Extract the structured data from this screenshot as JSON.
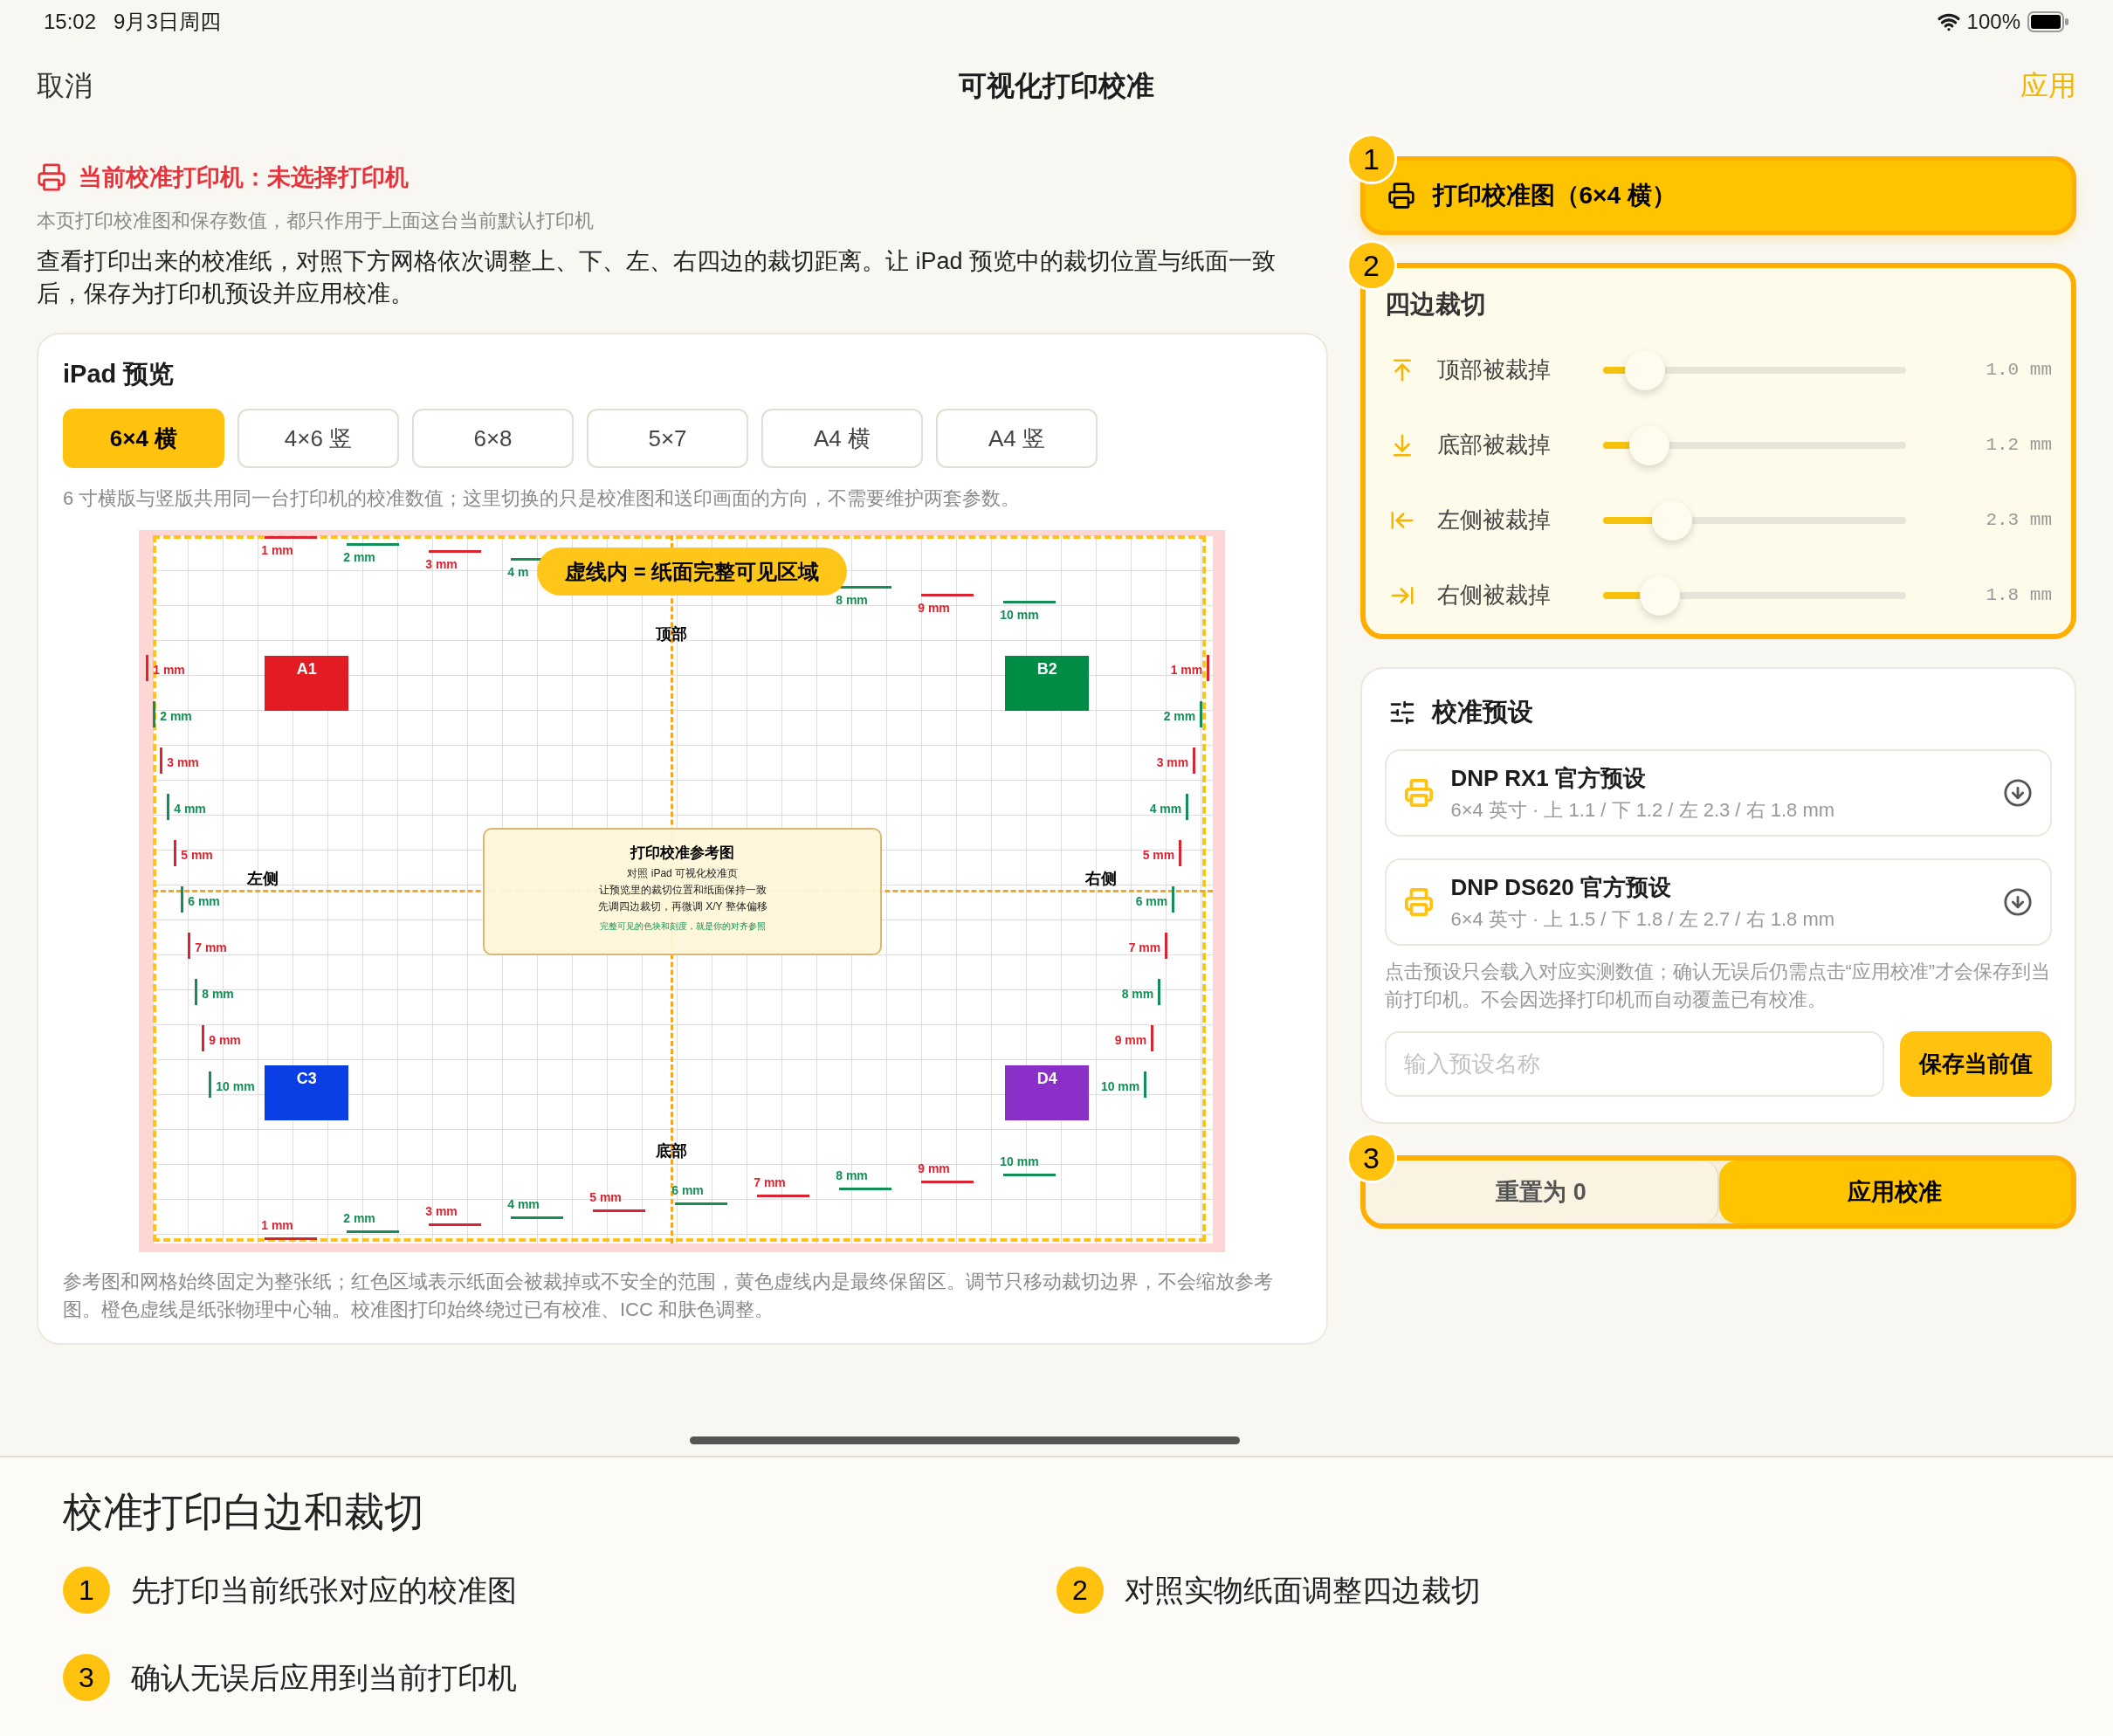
{
  "status_bar": {
    "time": "15:02",
    "date": "9月3日周四",
    "battery": "100%"
  },
  "nav": {
    "cancel": "取消",
    "title": "可视化打印校准",
    "apply": "应用"
  },
  "printer": {
    "label": "当前校准打印机：未选择打印机",
    "note": "本页打印校准图和保存数值，都只作用于上面这台当前默认打印机",
    "instructions": "查看打印出来的校准纸，对照下方网格依次调整上、下、左、右四边的裁切距离。让 iPad 预览中的裁切位置与纸面一致后，保存为打印机预设并应用校准。"
  },
  "preview": {
    "title": "iPad 预览",
    "tabs": [
      {
        "label": "6×4 横",
        "selected": true
      },
      {
        "label": "4×6 竖",
        "selected": false
      },
      {
        "label": "6×8",
        "selected": false
      },
      {
        "label": "5×7",
        "selected": false
      },
      {
        "label": "A4 横",
        "selected": false
      },
      {
        "label": "A4 竖",
        "selected": false
      }
    ],
    "note": "6 寸横版与竖版共用同一台打印机的校准数值；这里切换的只是校准图和送印画面的方向，不需要维护两套参数。",
    "chart": {
      "badge": "虚线内 = 纸面完整可见区域",
      "labels": [
        {
          "text": "顶部",
          "kind": "top"
        },
        {
          "text": "左侧",
          "kind": "left"
        },
        {
          "text": "右侧",
          "kind": "right"
        },
        {
          "text": "底部",
          "kind": "bottom"
        }
      ],
      "blocks": [
        {
          "label": "A1",
          "color": "#e31b23"
        },
        {
          "label": "B2",
          "color": "#008c45"
        },
        {
          "label": "C3",
          "color": "#0a3fe6"
        },
        {
          "label": "D4",
          "color": "#8a2fc8"
        }
      ],
      "scales": {
        "top": [
          {
            "label": "1 mm",
            "color": "#dc2430"
          },
          {
            "label": "2 mm",
            "color": "#138f55"
          },
          {
            "label": "3 mm",
            "color": "#dc2430"
          },
          {
            "label": "4 m",
            "color": "#138f55"
          },
          {
            "label": "8 mm",
            "color": "#138f55"
          },
          {
            "label": "9 mm",
            "color": "#dc2430"
          },
          {
            "label": "10 mm",
            "color": "#138f55"
          }
        ],
        "left": [
          {
            "label": "1 mm",
            "color": "#dc2430"
          },
          {
            "label": "2 mm",
            "color": "#138f55"
          },
          {
            "label": "3 mm",
            "color": "#dc2430"
          },
          {
            "label": "4 mm",
            "color": "#138f55"
          },
          {
            "label": "5 mm",
            "color": "#dc2430"
          },
          {
            "label": "6 mm",
            "color": "#138f55"
          },
          {
            "label": "7 mm",
            "color": "#dc2430"
          },
          {
            "label": "8 mm",
            "color": "#138f55"
          },
          {
            "label": "9 mm",
            "color": "#dc2430"
          },
          {
            "label": "10 mm",
            "color": "#138f55"
          }
        ],
        "right": [
          {
            "label": "1 mm",
            "color": "#dc2430"
          },
          {
            "label": "2 mm",
            "color": "#138f55"
          },
          {
            "label": "3 mm",
            "color": "#dc2430"
          },
          {
            "label": "4 mm",
            "color": "#138f55"
          },
          {
            "label": "5 mm",
            "color": "#dc2430"
          },
          {
            "label": "6 mm",
            "color": "#138f55"
          },
          {
            "label": "7 mm",
            "color": "#dc2430"
          },
          {
            "label": "8 mm",
            "color": "#138f55"
          },
          {
            "label": "9 mm",
            "color": "#dc2430"
          },
          {
            "label": "10 mm",
            "color": "#138f55"
          }
        ],
        "bottom": [
          {
            "label": "1 mm",
            "color": "#dc2430"
          },
          {
            "label": "2 mm",
            "color": "#138f55"
          },
          {
            "label": "3 mm",
            "color": "#dc2430"
          },
          {
            "label": "4 mm",
            "color": "#138f55"
          },
          {
            "label": "5 mm",
            "color": "#dc2430"
          },
          {
            "label": "6 mm",
            "color": "#138f55"
          },
          {
            "label": "7 mm",
            "color": "#dc2430"
          },
          {
            "label": "8 mm",
            "color": "#138f55"
          },
          {
            "label": "9 mm",
            "color": "#dc2430"
          },
          {
            "label": "10 mm",
            "color": "#138f55"
          }
        ]
      },
      "reference": {
        "title": "打印校准参考图",
        "lines": [
          "对照 iPad 可视化校准页",
          "让预览里的裁切位置和纸面保持一致",
          "先调四边裁切，再微调 X/Y 整体偏移"
        ],
        "hint": "完整可见的色块和刻度，就是你的对齐参照"
      }
    },
    "footnote": "参考图和网格始终固定为整张纸；红色区域表示纸面会被裁掉或不安全的范围，黄色虚线内是最终保留区。调节只移动裁切边界，不会缩放参考图。橙色虚线是纸张物理中心轴。校准图打印始终绕过已有校准、ICC 和肤色调整。"
  },
  "print_step": {
    "number": "1",
    "label": "打印校准图（6×4 横）"
  },
  "crop_step": {
    "number": "2",
    "title": "四边裁切",
    "sliders": [
      {
        "kind": "top",
        "label": "顶部被裁掉",
        "level": 0.14,
        "reading": "1.0 mm"
      },
      {
        "kind": "bottom",
        "label": "底部被裁掉",
        "level": 0.155,
        "reading": "1.2 mm"
      },
      {
        "kind": "left",
        "label": "左侧被裁掉",
        "level": 0.23,
        "reading": "2.3 mm"
      },
      {
        "kind": "right",
        "label": "右侧被裁掉",
        "level": 0.19,
        "reading": "1.8 mm"
      }
    ]
  },
  "presets": {
    "title": "校准预设",
    "items": [
      {
        "name": "DNP RX1 官方预设",
        "detail": "6×4 英寸 · 上 1.1 / 下 1.2 / 左 2.3 / 右 1.8 mm"
      },
      {
        "name": "DNP DS620 官方预设",
        "detail": "6×4 英寸 · 上 1.5 / 下 1.8 / 左 2.7 / 右 1.8 mm"
      }
    ],
    "note": "点击预设只会载入对应实测数值；确认无误后仍需点击“应用校准”才会保存到当前打印机。不会因选择打印机而自动覆盖已有校准。",
    "placeholder": "输入预设名称",
    "save": "保存当前值"
  },
  "apply_step": {
    "number": "3",
    "buttons": [
      {
        "label": "重置为 0",
        "kind": "secondary"
      },
      {
        "label": "应用校准",
        "kind": "primary"
      }
    ]
  },
  "guide": {
    "title": "校准打印白边和裁切",
    "steps": [
      {
        "number": "1",
        "text": "先打印当前纸张对应的校准图"
      },
      {
        "number": "2",
        "text": "对照实物纸面调整四边裁切"
      },
      {
        "number": "3",
        "text": "确认无误后应用到当前打印机"
      }
    ]
  }
}
